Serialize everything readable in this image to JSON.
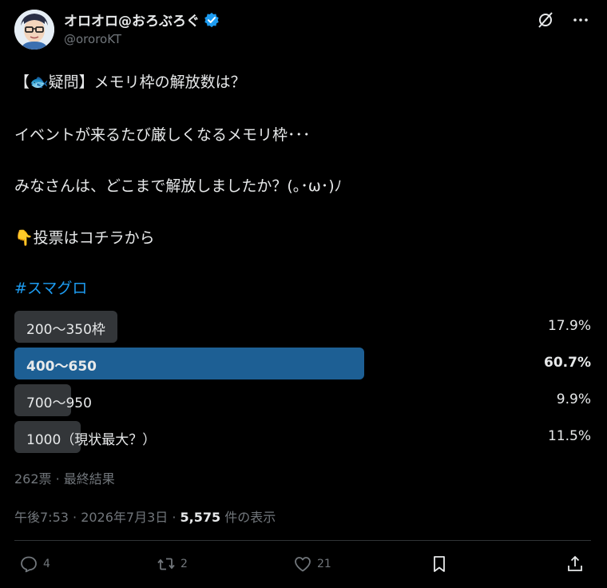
{
  "author": {
    "display_name": "オロオロ@おろぶろぐ",
    "handle": "@ororoKT",
    "verified": true
  },
  "tweet": {
    "line1": "【🐟疑問】メモリ枠の解放数は？",
    "line2": "イベントが来るたび厳しくなるメモリ枠･･･",
    "line3": "みなさんは、どこまで解放しましたか？(｡･ω･)ﾉ",
    "line4": "👇投票はコチラから",
    "hashtag": "#スマグロ"
  },
  "poll": {
    "options": [
      {
        "label": "200〜350枠",
        "percent_text": "17.9%",
        "percent": 17.9,
        "winner": false
      },
      {
        "label": "400〜650",
        "percent_text": "60.7%",
        "percent": 60.7,
        "winner": true
      },
      {
        "label": "700〜950",
        "percent_text": "9.9%",
        "percent": 9.9,
        "winner": false
      },
      {
        "label": "1000（現状最大？）",
        "percent_text": "11.5%",
        "percent": 11.5,
        "winner": false
      }
    ],
    "summary": "262票 · 最終結果"
  },
  "meta": {
    "timestamp": "午後7:53 · 2026年7月3日 · ",
    "views_count": "5,575",
    "views_label": " 件の表示"
  },
  "actions": {
    "reply_count": "4",
    "retweet_count": "2",
    "like_count": "21"
  },
  "colors": {
    "accent": "#1d9bf0",
    "winner_bar": "#1d5f94",
    "bar": "#333639"
  }
}
